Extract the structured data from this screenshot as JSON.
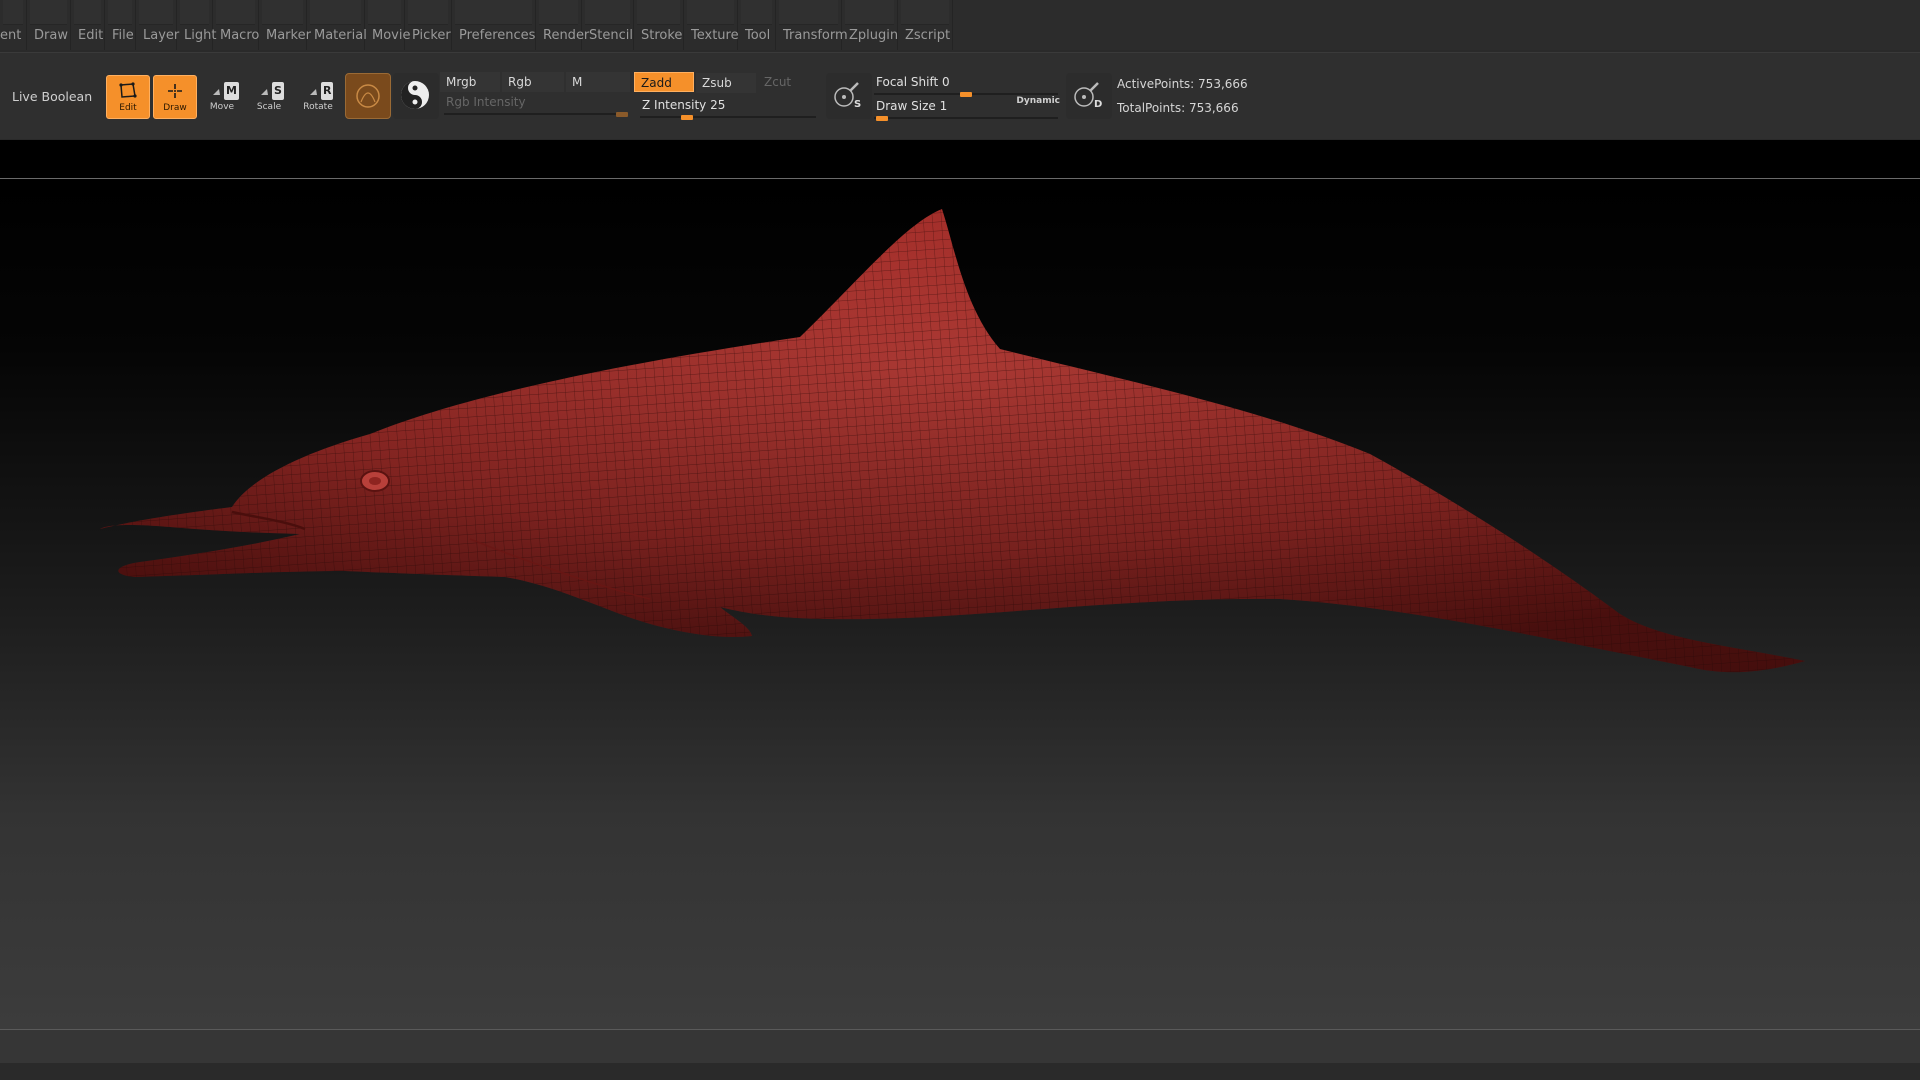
{
  "menu": {
    "items": [
      "ent",
      "Draw",
      "Edit",
      "File",
      "Layer",
      "Light",
      "Macro",
      "Marker",
      "Material",
      "Movie",
      "Picker",
      "Preferences",
      "Render",
      "Stencil",
      "Stroke",
      "Texture",
      "Tool",
      "Transform",
      "Zplugin",
      "Zscript"
    ]
  },
  "shelf": {
    "live_boolean": "Live Boolean",
    "tools": {
      "edit": "Edit",
      "draw": "Draw",
      "move": "Move",
      "scale": "Scale",
      "rotate": "Rotate"
    },
    "badges": {
      "move": "M",
      "scale": "S",
      "rotate": "R"
    },
    "color_modes": {
      "mrgb": "Mrgb",
      "rgb": "Rgb",
      "m": "M"
    },
    "rgb_intensity": {
      "label": "Rgb Intensity",
      "value": 100
    },
    "z_modes": {
      "zadd": "Zadd",
      "zsub": "Zsub",
      "zcut": "Zcut"
    },
    "z_intensity": {
      "label": "Z Intensity",
      "value": "25",
      "fraction": 0.25
    },
    "focal_shift": {
      "label": "Focal Shift",
      "value": "0",
      "fraction": 0.5
    },
    "draw_size": {
      "label": "Draw Size",
      "value": "1",
      "fraction": 0.01
    },
    "dynamic": "Dynamic",
    "stats": {
      "active_label": "ActivePoints:",
      "active_value": "753,666",
      "total_label": "TotalPoints:",
      "total_value": "753,666"
    },
    "icon_badges": {
      "s": "S",
      "d": "D"
    }
  },
  "colors": {
    "accent": "#f5902a",
    "mesh": "#a8302c",
    "wire": "#3a0c0a"
  }
}
